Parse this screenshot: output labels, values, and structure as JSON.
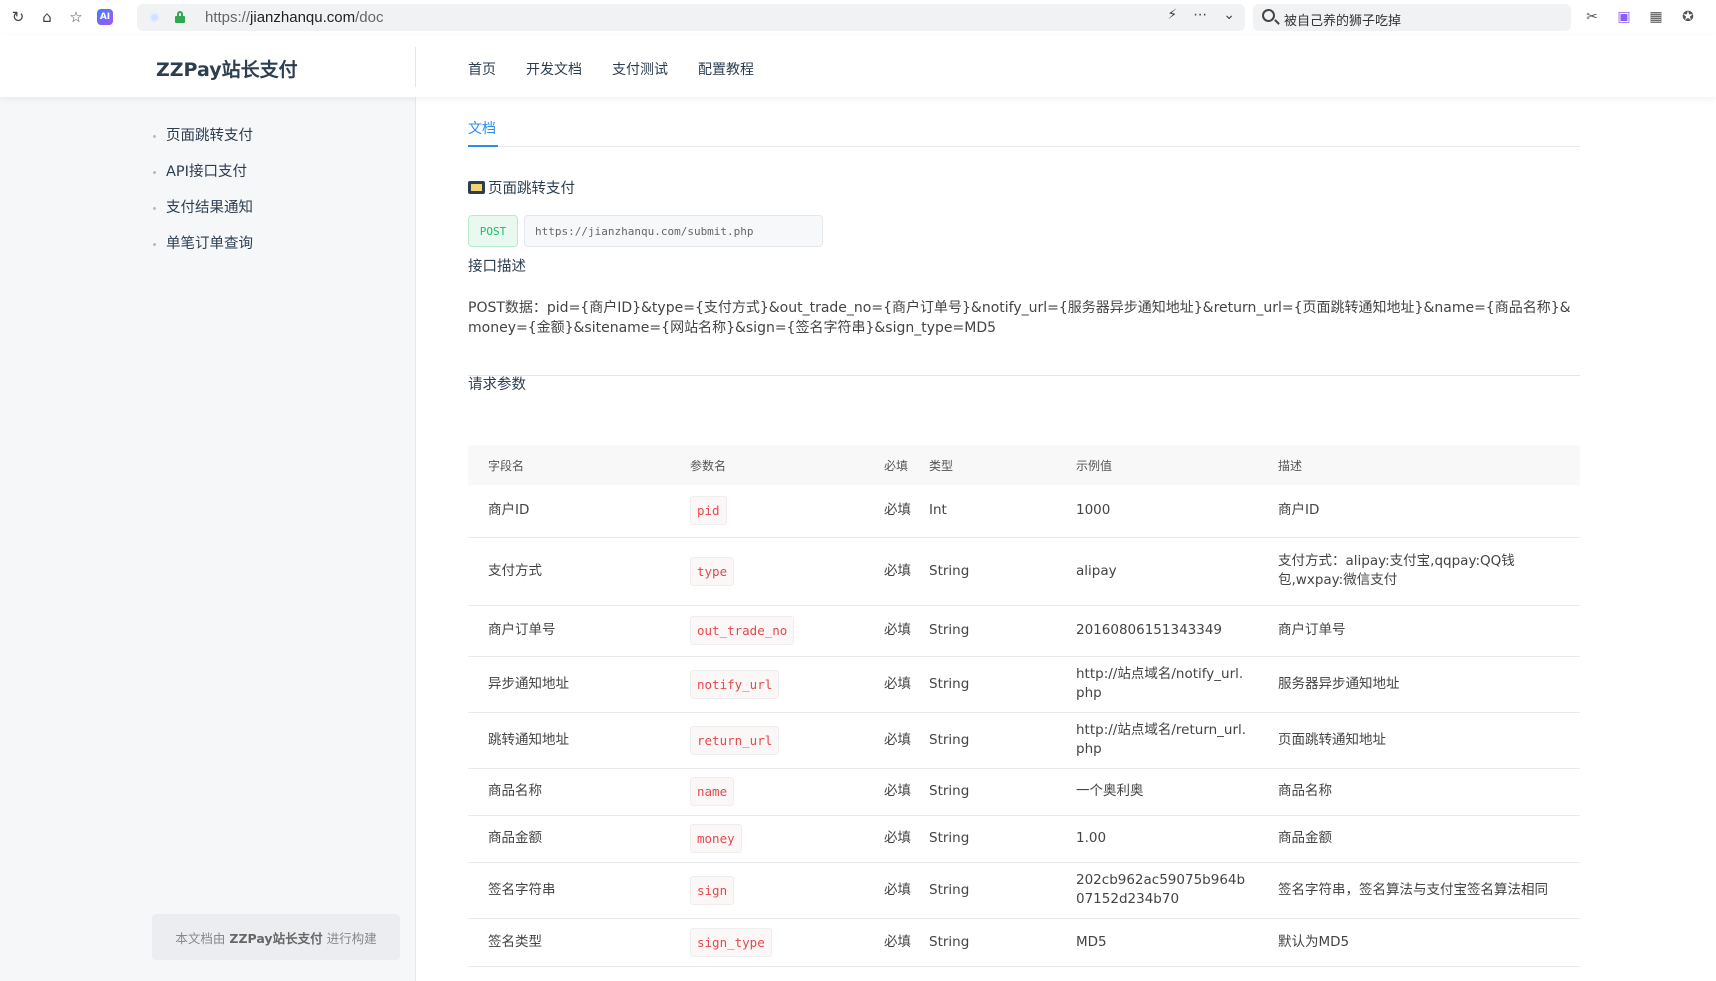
{
  "browser": {
    "url_scheme": "https://",
    "url_host": "jianzhanqu.com",
    "url_path": "/doc",
    "search_query": "被自己养的狮子吃掉",
    "ai_badge": "AI"
  },
  "header": {
    "brand": "ZZPay站长支付",
    "nav": [
      "首页",
      "开发文档",
      "支付测试",
      "配置教程"
    ]
  },
  "sidebar": {
    "items": [
      "页面跳转支付",
      "API接口支付",
      "支付结果通知",
      "单笔订单查询"
    ],
    "footer_prefix": "本文档由",
    "footer_brand": "ZZPay站长支付",
    "footer_suffix": "进行构建"
  },
  "main": {
    "tab": "文档",
    "doc_title": "页面跳转支付",
    "method": "POST",
    "endpoint": "https://jianzhanqu.com/submit.php",
    "desc_heading": "接口描述",
    "desc_text": "POST数据：pid={商户ID}&type={支付方式}&out_trade_no={商户订单号}&notify_url={服务器异步通知地址}&return_url={页面跳转通知地址}&name={商品名称}&money={金额}&sitename={网站名称}&sign={签名字符串}&sign_type=MD5",
    "params_heading": "请求参数",
    "table": {
      "headers": [
        "字段名",
        "参数名",
        "必填",
        "类型",
        "示例值",
        "描述"
      ],
      "rows": [
        {
          "field": "商户ID",
          "param": "pid",
          "required": "必填",
          "type": "Int",
          "example": "1000",
          "desc": "商户ID"
        },
        {
          "field": "支付方式",
          "param": "type",
          "required": "必填",
          "type": "String",
          "example": "alipay",
          "desc": "支付方式：alipay:支付宝,qqpay:QQ钱包,wxpay:微信支付"
        },
        {
          "field": "商户订单号",
          "param": "out_trade_no",
          "required": "必填",
          "type": "String",
          "example": "20160806151343349",
          "desc": "商户订单号"
        },
        {
          "field": "异步通知地址",
          "param": "notify_url",
          "required": "必填",
          "type": "String",
          "example": "http://站点域名/notify_url.php",
          "desc": "服务器异步通知地址"
        },
        {
          "field": "跳转通知地址",
          "param": "return_url",
          "required": "必填",
          "type": "String",
          "example": "http://站点域名/return_url.php",
          "desc": "页面跳转通知地址"
        },
        {
          "field": "商品名称",
          "param": "name",
          "required": "必填",
          "type": "String",
          "example": "一个奥利奥",
          "desc": "商品名称"
        },
        {
          "field": "商品金额",
          "param": "money",
          "required": "必填",
          "type": "String",
          "example": "1.00",
          "desc": "商品金额"
        },
        {
          "field": "签名字符串",
          "param": "sign",
          "required": "必填",
          "type": "String",
          "example": "202cb962ac59075b964b07152d234b70",
          "desc": "签名字符串，签名算法与支付宝签名算法相同"
        },
        {
          "field": "签名类型",
          "param": "sign_type",
          "required": "必填",
          "type": "String",
          "example": "MD5",
          "desc": "默认为MD5"
        }
      ]
    }
  }
}
